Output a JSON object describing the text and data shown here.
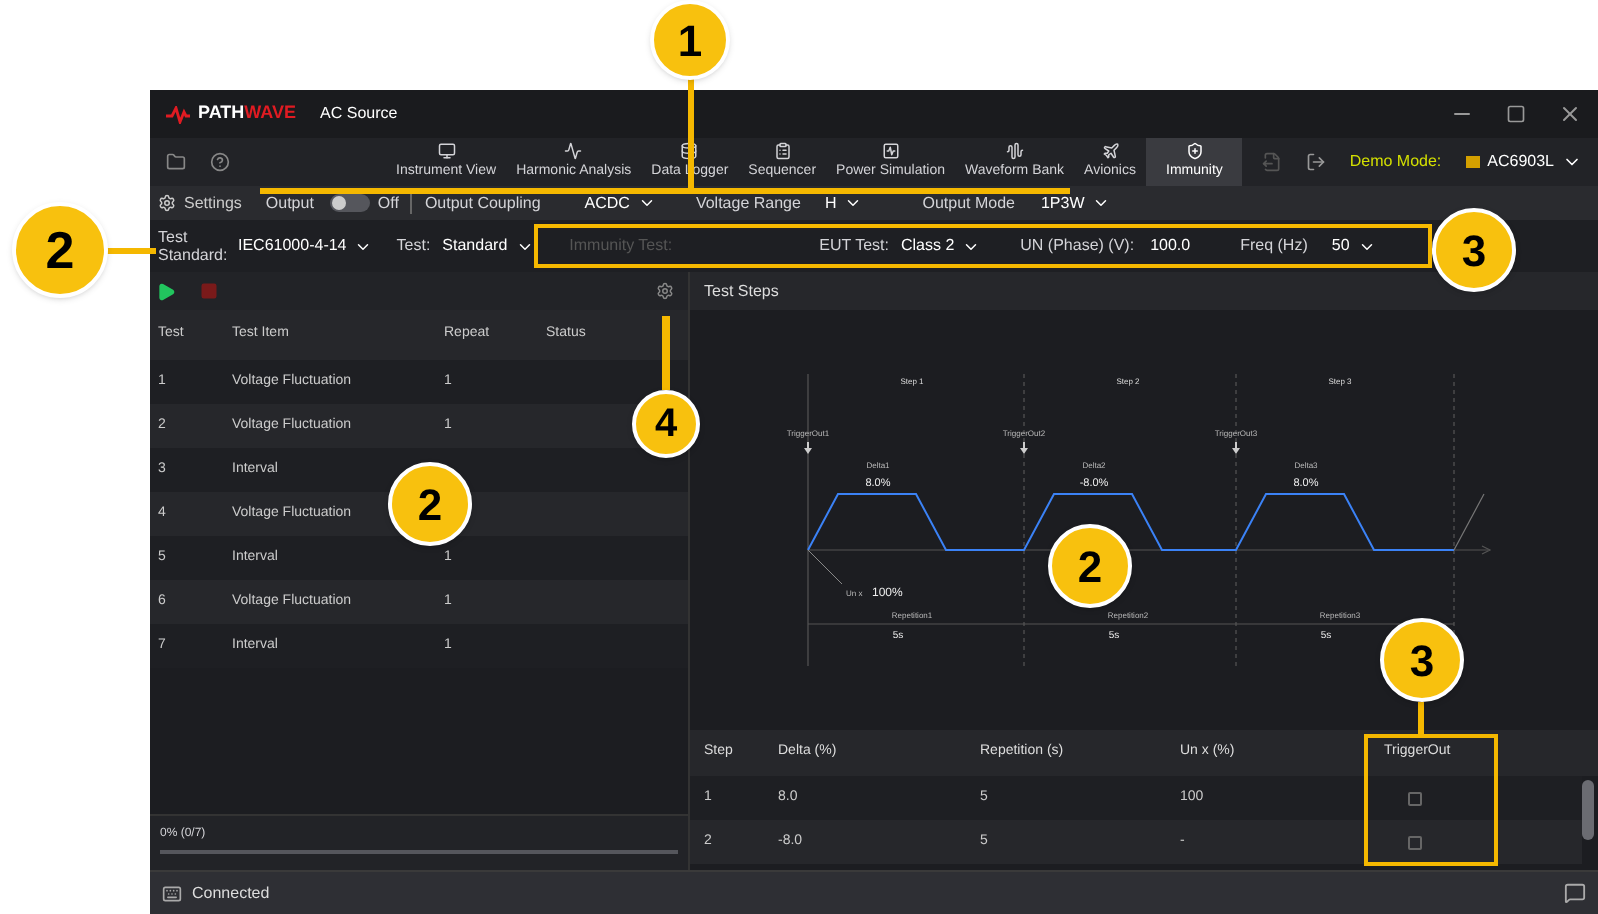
{
  "app": {
    "brand_a": "PATH",
    "brand_b": "WAVE",
    "title": "AC Source"
  },
  "nav": {
    "tabs": [
      {
        "label": "Instrument View",
        "selected": false
      },
      {
        "label": "Harmonic Analysis",
        "selected": false
      },
      {
        "label": "Data Logger",
        "selected": false
      },
      {
        "label": "Sequencer",
        "selected": false
      },
      {
        "label": "Power Simulation",
        "selected": false
      },
      {
        "label": "Waveform Bank",
        "selected": false
      },
      {
        "label": "Avionics",
        "selected": false
      },
      {
        "label": "Immunity",
        "selected": true
      }
    ],
    "mode_label": "Demo Mode:",
    "instrument": "AC6903L"
  },
  "settings_bar": {
    "settings": "Settings",
    "output_label": "Output",
    "output_on": false,
    "output_state": "Off",
    "fields": [
      {
        "label": "Output Coupling",
        "value": "ACDC"
      },
      {
        "label": "Voltage Range",
        "value": "H"
      },
      {
        "label": "Output Mode",
        "value": "1P3W"
      }
    ]
  },
  "test_bar": {
    "standard_label": "Test Standard:",
    "standard": "IEC61000-4-14",
    "test_label": "Test:",
    "test": "Standard",
    "immunity_placeholder": "Immunity Test:",
    "eut_label": "EUT Test:",
    "eut": "Class 2",
    "un_label": "UN (Phase) (V):",
    "un": "100.0",
    "freq_label": "Freq (Hz)",
    "freq": "50"
  },
  "test_list": {
    "columns": [
      "Test",
      "Test Item",
      "Repeat",
      "Status"
    ],
    "rows": [
      {
        "test": "1",
        "item": "Voltage Fluctuation",
        "repeat": "1"
      },
      {
        "test": "2",
        "item": "Voltage Fluctuation",
        "repeat": "1"
      },
      {
        "test": "3",
        "item": "Interval",
        "repeat": ""
      },
      {
        "test": "4",
        "item": "Voltage Fluctuation",
        "repeat": ""
      },
      {
        "test": "5",
        "item": "Interval",
        "repeat": "1"
      },
      {
        "test": "6",
        "item": "Voltage Fluctuation",
        "repeat": "1"
      },
      {
        "test": "7",
        "item": "Interval",
        "repeat": "1"
      }
    ],
    "progress": "0% (0/7)",
    "level": 0
  },
  "test_steps": {
    "title": "Test Steps",
    "diagram": {
      "steps": [
        {
          "label": "Step 1",
          "trigger": "TriggerOut1",
          "delta_label": "Delta1",
          "delta": "8.0%",
          "rep_label": "Repetition1",
          "rep": "5s"
        },
        {
          "label": "Step 2",
          "trigger": "TriggerOut2",
          "delta_label": "Delta2",
          "delta": "-8.0%",
          "rep_label": "Repetition2",
          "rep": "5s"
        },
        {
          "label": "Step 3",
          "trigger": "TriggerOut3",
          "delta_label": "Delta3",
          "delta": "8.0%",
          "rep_label": "Repetition3",
          "rep": "5s"
        }
      ],
      "base_label": "Un x",
      "base_value": "100%"
    },
    "table": {
      "columns": [
        "Step",
        "Delta (%)",
        "Repetition (s)",
        "Un x (%)",
        "TriggerOut"
      ],
      "rows": [
        {
          "step": "1",
          "delta": "8.0",
          "repetition": "5",
          "un": "100",
          "trigger_out": false
        },
        {
          "step": "2",
          "delta": "-8.0",
          "repetition": "5",
          "un": "-",
          "trigger_out": false
        }
      ]
    }
  },
  "status_bar": {
    "text": "Connected"
  },
  "callouts": [
    {
      "number": "1"
    },
    {
      "number": "2"
    },
    {
      "number": "3"
    },
    {
      "number": "4"
    },
    {
      "number": "2"
    },
    {
      "number": "2"
    },
    {
      "number": "3"
    }
  ]
}
